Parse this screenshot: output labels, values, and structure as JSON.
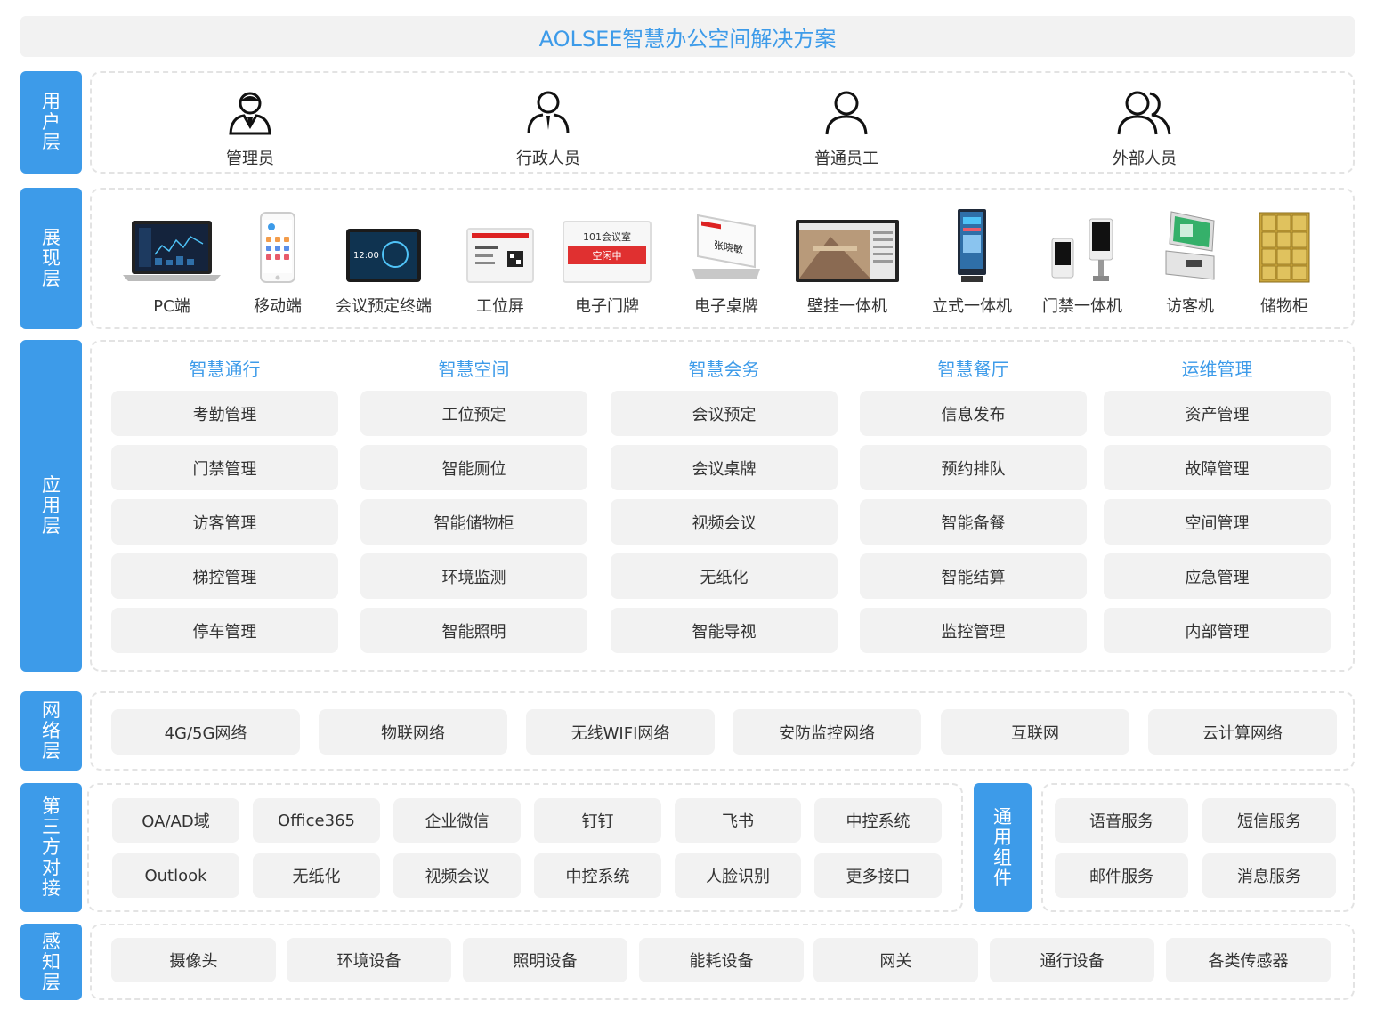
{
  "title": "AOLSEE智慧办公空间解决方案",
  "layers": {
    "user": "用户层",
    "display": "展现层",
    "app": "应用层",
    "network": "网络层",
    "third": "第三方对接",
    "common": "通用组件",
    "sense": "感知层"
  },
  "users": [
    "管理员",
    "行政人员",
    "普通员工",
    "外部人员"
  ],
  "devices": [
    "PC端",
    "移动端",
    "会议预定终端",
    "工位屏",
    "电子门牌",
    "电子桌牌",
    "壁挂一体机",
    "立式一体机",
    "门禁一体机",
    "访客机",
    "储物柜"
  ],
  "device_screen_text": {
    "pad_time": "12:00",
    "door_room": "101会议室",
    "door_status": "空闲中",
    "table_name": "张晓敏"
  },
  "app_columns": [
    {
      "title": "智慧通行",
      "items": [
        "考勤管理",
        "门禁管理",
        "访客管理",
        "梯控管理",
        "停车管理"
      ]
    },
    {
      "title": "智慧空间",
      "items": [
        "工位预定",
        "智能厕位",
        "智能储物柜",
        "环境监测",
        "智能照明"
      ]
    },
    {
      "title": "智慧会务",
      "items": [
        "会议预定",
        "会议桌牌",
        "视频会议",
        "无纸化",
        "智能导视"
      ]
    },
    {
      "title": "智慧餐厅",
      "items": [
        "信息发布",
        "预约排队",
        "智能备餐",
        "智能结算",
        "监控管理"
      ]
    },
    {
      "title": "运维管理",
      "items": [
        "资产管理",
        "故障管理",
        "空间管理",
        "应急管理",
        "内部管理"
      ]
    }
  ],
  "network": [
    "4G/5G网络",
    "物联网络",
    "无线WIFI网络",
    "安防监控网络",
    "互联网",
    "云计算网络"
  ],
  "third_party": [
    "OA/AD域",
    "Office365",
    "企业微信",
    "钉钉",
    "飞书",
    "中控系统",
    "Outlook",
    "无纸化",
    "视频会议",
    "中控系统",
    "人脸识别",
    "更多接口"
  ],
  "common_components": [
    "语音服务",
    "短信服务",
    "邮件服务",
    "消息服务"
  ],
  "sense": [
    "摄像头",
    "环境设备",
    "照明设备",
    "能耗设备",
    "网关",
    "通行设备",
    "各类传感器"
  ],
  "colors": {
    "accent": "#3d9be9",
    "cell_bg": "#f2f2f2",
    "door_red": "#e03030"
  }
}
